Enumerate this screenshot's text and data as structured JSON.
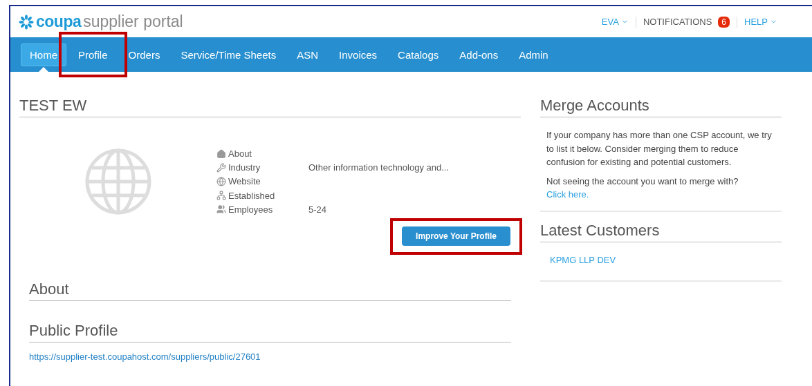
{
  "header": {
    "logo_brand": "coupa",
    "logo_suffix": "supplier portal",
    "user_menu": "EVA",
    "notifications": {
      "label": "NOTIFICATIONS",
      "count": "6"
    },
    "help_menu": "HELP"
  },
  "nav": [
    {
      "label": "Home",
      "selected": true,
      "highlighted": false
    },
    {
      "label": "Profile",
      "selected": false,
      "highlighted": true
    },
    {
      "label": "Orders",
      "selected": false,
      "highlighted": false
    },
    {
      "label": "Service/Time Sheets",
      "selected": false,
      "highlighted": false
    },
    {
      "label": "ASN",
      "selected": false,
      "highlighted": false
    },
    {
      "label": "Invoices",
      "selected": false,
      "highlighted": false
    },
    {
      "label": "Catalogs",
      "selected": false,
      "highlighted": false
    },
    {
      "label": "Add-ons",
      "selected": false,
      "highlighted": false
    },
    {
      "label": "Admin",
      "selected": false,
      "highlighted": false
    }
  ],
  "profile": {
    "title": "TEST EW",
    "details": [
      {
        "kind": "about",
        "label": "About"
      },
      {
        "kind": "industry",
        "label": "Industry",
        "value": "Other information technology and..."
      },
      {
        "kind": "website",
        "label": "Website"
      },
      {
        "kind": "established",
        "label": "Established"
      },
      {
        "kind": "employees",
        "label": "Employees",
        "value": "5-24"
      }
    ],
    "button": {
      "label": "Improve Your Profile",
      "highlighted": true
    }
  },
  "about": {
    "title": "About"
  },
  "public_profile": {
    "title": "Public Profile",
    "url": "https://supplier-test.coupahost.com/suppliers/public/27601"
  },
  "merge_accounts": {
    "title": "Merge Accounts",
    "text": "If your company has more than one CSP account, we try to list it below. Consider merging them to reduce confusion for existing and potential customers.",
    "prompt": "Not seeing the account you want to merge with?",
    "link": "Click here."
  },
  "latest_customers": {
    "title": "Latest Customers",
    "items": [
      "KPMG LLP DEV"
    ]
  }
}
